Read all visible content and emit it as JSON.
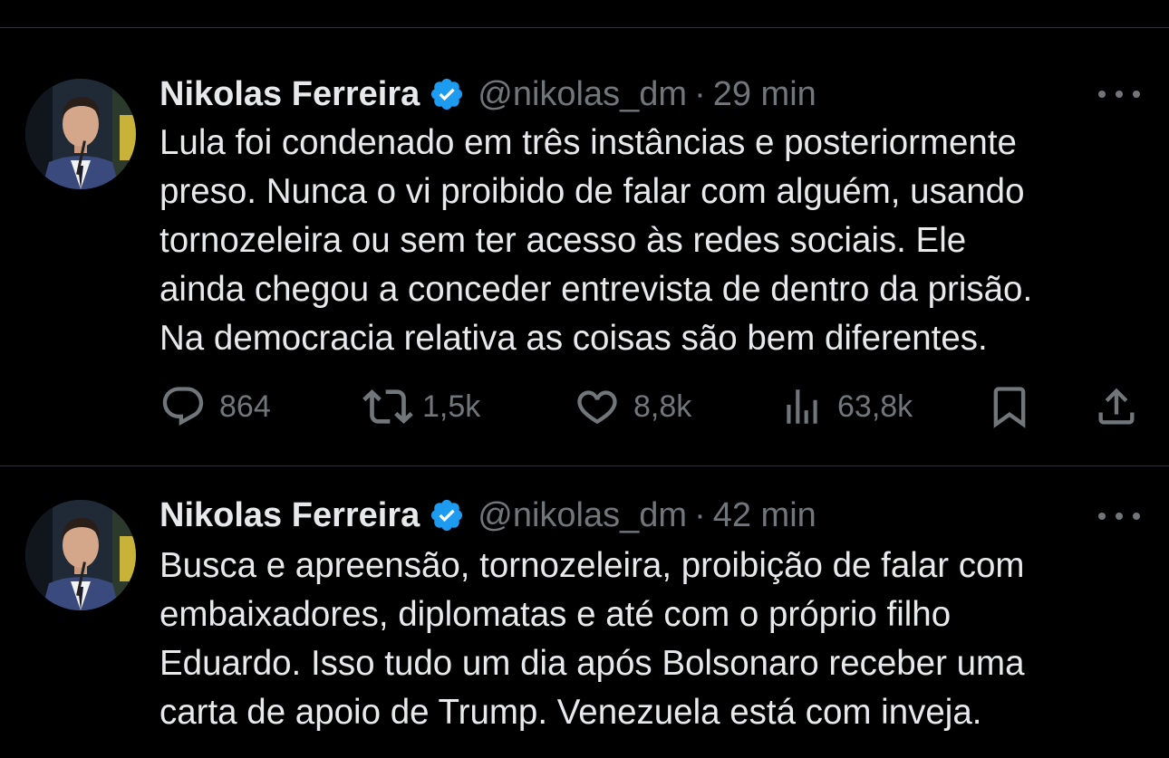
{
  "tweets": [
    {
      "author_name": "Nikolas Ferreira",
      "handle": "@nikolas_dm",
      "separator": "·",
      "time": "29 min",
      "text": "Lula foi condenado em três instâncias e posteriormente\npreso. Nunca o vi proibido de falar com alguém, usando\ntornozeleira ou sem ter acesso às redes sociais. Ele\nainda chegou a conceder entrevista de dentro da prisão.\nNa democracia relativa as coisas são bem diferentes.",
      "replies": "864",
      "reposts": "1,5k",
      "likes": "8,8k",
      "views": "63,8k"
    },
    {
      "author_name": "Nikolas Ferreira",
      "handle": "@nikolas_dm",
      "separator": "·",
      "time": "42 min",
      "text": "Busca e apreensão, tornozeleira, proibição de falar com\nembaixadores, diplomatas e até com o próprio filho\nEduardo. Isso tudo um dia após Bolsonaro receber uma\ncarta de apoio de Trump. Venezuela está com inveja."
    }
  ],
  "icons": {
    "verified": "verified-badge-icon",
    "more": "more-horizontal-icon",
    "reply": "reply-bubble-icon",
    "repost": "repost-icon",
    "like": "heart-icon",
    "views": "views-chart-icon",
    "bookmark": "bookmark-icon",
    "share": "share-icon"
  },
  "colors": {
    "background": "#000000",
    "text_primary": "#e7e9ea",
    "text_secondary": "#71767b",
    "verified": "#1d9bf0",
    "divider": "#2f3336"
  }
}
